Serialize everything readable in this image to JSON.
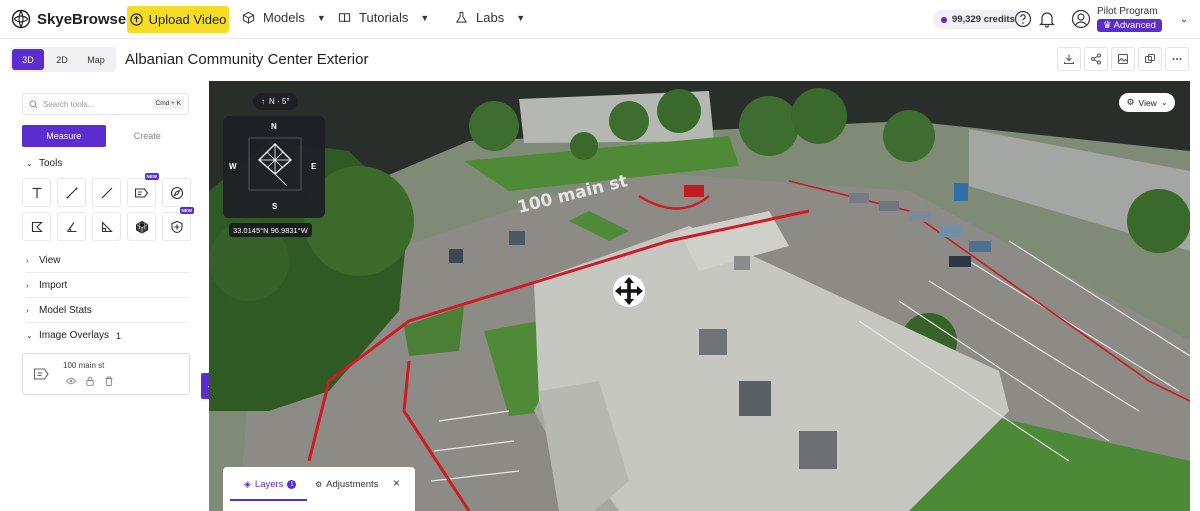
{
  "app": {
    "logo_text": "SkyeBrowse",
    "upload_label": "Upload Video",
    "nav": [
      {
        "label": "Models",
        "icon": "cube-icon"
      },
      {
        "label": "Tutorials",
        "icon": "book-icon"
      },
      {
        "label": "Labs",
        "icon": "flask-icon"
      }
    ],
    "credits": "99,329 credits",
    "user": {
      "program": "Pilot Program",
      "tier": "Advanced"
    }
  },
  "subbar": {
    "modes": [
      "3D",
      "2D",
      "Map"
    ],
    "active_mode": "3D",
    "title": "Albanian Community Center Exterior",
    "actions": [
      "download-icon",
      "share-icon",
      "image-icon",
      "copy-icon",
      "more-icon"
    ]
  },
  "sidebar": {
    "search_placeholder": "Search tools...",
    "search_shortcut": "Cmd + K",
    "tabs": [
      "Measure",
      "Create"
    ],
    "tools_label": "Tools",
    "tool_new_badge": "NEW",
    "sections": [
      "View",
      "Import",
      "Model Stats"
    ],
    "image_overlays_label": "Image Overlays",
    "image_overlays_count": "1",
    "overlay_item_name": "100 main st"
  },
  "viewport": {
    "heading": "N · 5°",
    "compass_dirs": {
      "n": "N",
      "s": "S",
      "e": "E",
      "w": "W"
    },
    "coordinates": "33.0145°N 96.9831°W",
    "view_label": "View",
    "scene_label": "100 main st"
  },
  "layers_panel": {
    "layers_label": "Layers",
    "layers_count": "1",
    "adjustments_label": "Adjustments",
    "close_label": "×"
  },
  "colors": {
    "accent": "#5b2ccf",
    "upload": "#f5dd25"
  }
}
